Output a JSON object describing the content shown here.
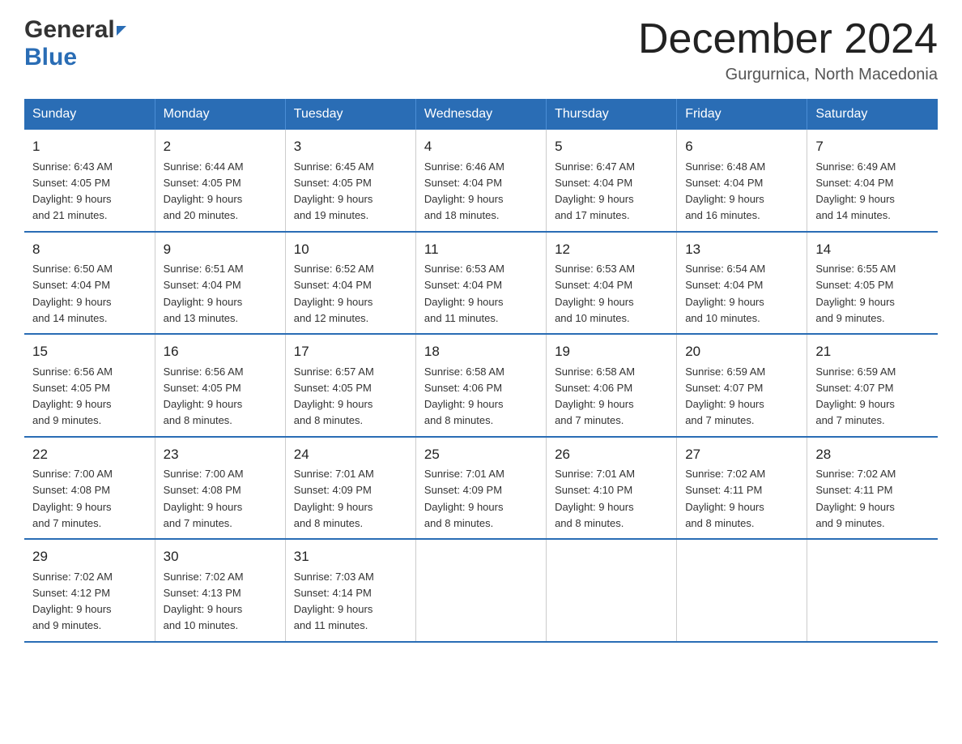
{
  "header": {
    "logo_general": "General",
    "logo_blue": "Blue",
    "month_title": "December 2024",
    "location": "Gurgurnica, North Macedonia"
  },
  "days_of_week": [
    "Sunday",
    "Monday",
    "Tuesday",
    "Wednesday",
    "Thursday",
    "Friday",
    "Saturday"
  ],
  "weeks": [
    [
      {
        "day": "1",
        "sunrise": "6:43 AM",
        "sunset": "4:05 PM",
        "daylight_hours": "9",
        "daylight_minutes": "21"
      },
      {
        "day": "2",
        "sunrise": "6:44 AM",
        "sunset": "4:05 PM",
        "daylight_hours": "9",
        "daylight_minutes": "20"
      },
      {
        "day": "3",
        "sunrise": "6:45 AM",
        "sunset": "4:05 PM",
        "daylight_hours": "9",
        "daylight_minutes": "19"
      },
      {
        "day": "4",
        "sunrise": "6:46 AM",
        "sunset": "4:04 PM",
        "daylight_hours": "9",
        "daylight_minutes": "18"
      },
      {
        "day": "5",
        "sunrise": "6:47 AM",
        "sunset": "4:04 PM",
        "daylight_hours": "9",
        "daylight_minutes": "17"
      },
      {
        "day": "6",
        "sunrise": "6:48 AM",
        "sunset": "4:04 PM",
        "daylight_hours": "9",
        "daylight_minutes": "16"
      },
      {
        "day": "7",
        "sunrise": "6:49 AM",
        "sunset": "4:04 PM",
        "daylight_hours": "9",
        "daylight_minutes": "14"
      }
    ],
    [
      {
        "day": "8",
        "sunrise": "6:50 AM",
        "sunset": "4:04 PM",
        "daylight_hours": "9",
        "daylight_minutes": "14"
      },
      {
        "day": "9",
        "sunrise": "6:51 AM",
        "sunset": "4:04 PM",
        "daylight_hours": "9",
        "daylight_minutes": "13"
      },
      {
        "day": "10",
        "sunrise": "6:52 AM",
        "sunset": "4:04 PM",
        "daylight_hours": "9",
        "daylight_minutes": "12"
      },
      {
        "day": "11",
        "sunrise": "6:53 AM",
        "sunset": "4:04 PM",
        "daylight_hours": "9",
        "daylight_minutes": "11"
      },
      {
        "day": "12",
        "sunrise": "6:53 AM",
        "sunset": "4:04 PM",
        "daylight_hours": "9",
        "daylight_minutes": "10"
      },
      {
        "day": "13",
        "sunrise": "6:54 AM",
        "sunset": "4:04 PM",
        "daylight_hours": "9",
        "daylight_minutes": "10"
      },
      {
        "day": "14",
        "sunrise": "6:55 AM",
        "sunset": "4:05 PM",
        "daylight_hours": "9",
        "daylight_minutes": "9"
      }
    ],
    [
      {
        "day": "15",
        "sunrise": "6:56 AM",
        "sunset": "4:05 PM",
        "daylight_hours": "9",
        "daylight_minutes": "9"
      },
      {
        "day": "16",
        "sunrise": "6:56 AM",
        "sunset": "4:05 PM",
        "daylight_hours": "9",
        "daylight_minutes": "8"
      },
      {
        "day": "17",
        "sunrise": "6:57 AM",
        "sunset": "4:05 PM",
        "daylight_hours": "9",
        "daylight_minutes": "8"
      },
      {
        "day": "18",
        "sunrise": "6:58 AM",
        "sunset": "4:06 PM",
        "daylight_hours": "9",
        "daylight_minutes": "8"
      },
      {
        "day": "19",
        "sunrise": "6:58 AM",
        "sunset": "4:06 PM",
        "daylight_hours": "9",
        "daylight_minutes": "7"
      },
      {
        "day": "20",
        "sunrise": "6:59 AM",
        "sunset": "4:07 PM",
        "daylight_hours": "9",
        "daylight_minutes": "7"
      },
      {
        "day": "21",
        "sunrise": "6:59 AM",
        "sunset": "4:07 PM",
        "daylight_hours": "9",
        "daylight_minutes": "7"
      }
    ],
    [
      {
        "day": "22",
        "sunrise": "7:00 AM",
        "sunset": "4:08 PM",
        "daylight_hours": "9",
        "daylight_minutes": "7"
      },
      {
        "day": "23",
        "sunrise": "7:00 AM",
        "sunset": "4:08 PM",
        "daylight_hours": "9",
        "daylight_minutes": "7"
      },
      {
        "day": "24",
        "sunrise": "7:01 AM",
        "sunset": "4:09 PM",
        "daylight_hours": "9",
        "daylight_minutes": "8"
      },
      {
        "day": "25",
        "sunrise": "7:01 AM",
        "sunset": "4:09 PM",
        "daylight_hours": "9",
        "daylight_minutes": "8"
      },
      {
        "day": "26",
        "sunrise": "7:01 AM",
        "sunset": "4:10 PM",
        "daylight_hours": "9",
        "daylight_minutes": "8"
      },
      {
        "day": "27",
        "sunrise": "7:02 AM",
        "sunset": "4:11 PM",
        "daylight_hours": "9",
        "daylight_minutes": "8"
      },
      {
        "day": "28",
        "sunrise": "7:02 AM",
        "sunset": "4:11 PM",
        "daylight_hours": "9",
        "daylight_minutes": "9"
      }
    ],
    [
      {
        "day": "29",
        "sunrise": "7:02 AM",
        "sunset": "4:12 PM",
        "daylight_hours": "9",
        "daylight_minutes": "9"
      },
      {
        "day": "30",
        "sunrise": "7:02 AM",
        "sunset": "4:13 PM",
        "daylight_hours": "9",
        "daylight_minutes": "10"
      },
      {
        "day": "31",
        "sunrise": "7:03 AM",
        "sunset": "4:14 PM",
        "daylight_hours": "9",
        "daylight_minutes": "11"
      },
      null,
      null,
      null,
      null
    ]
  ]
}
